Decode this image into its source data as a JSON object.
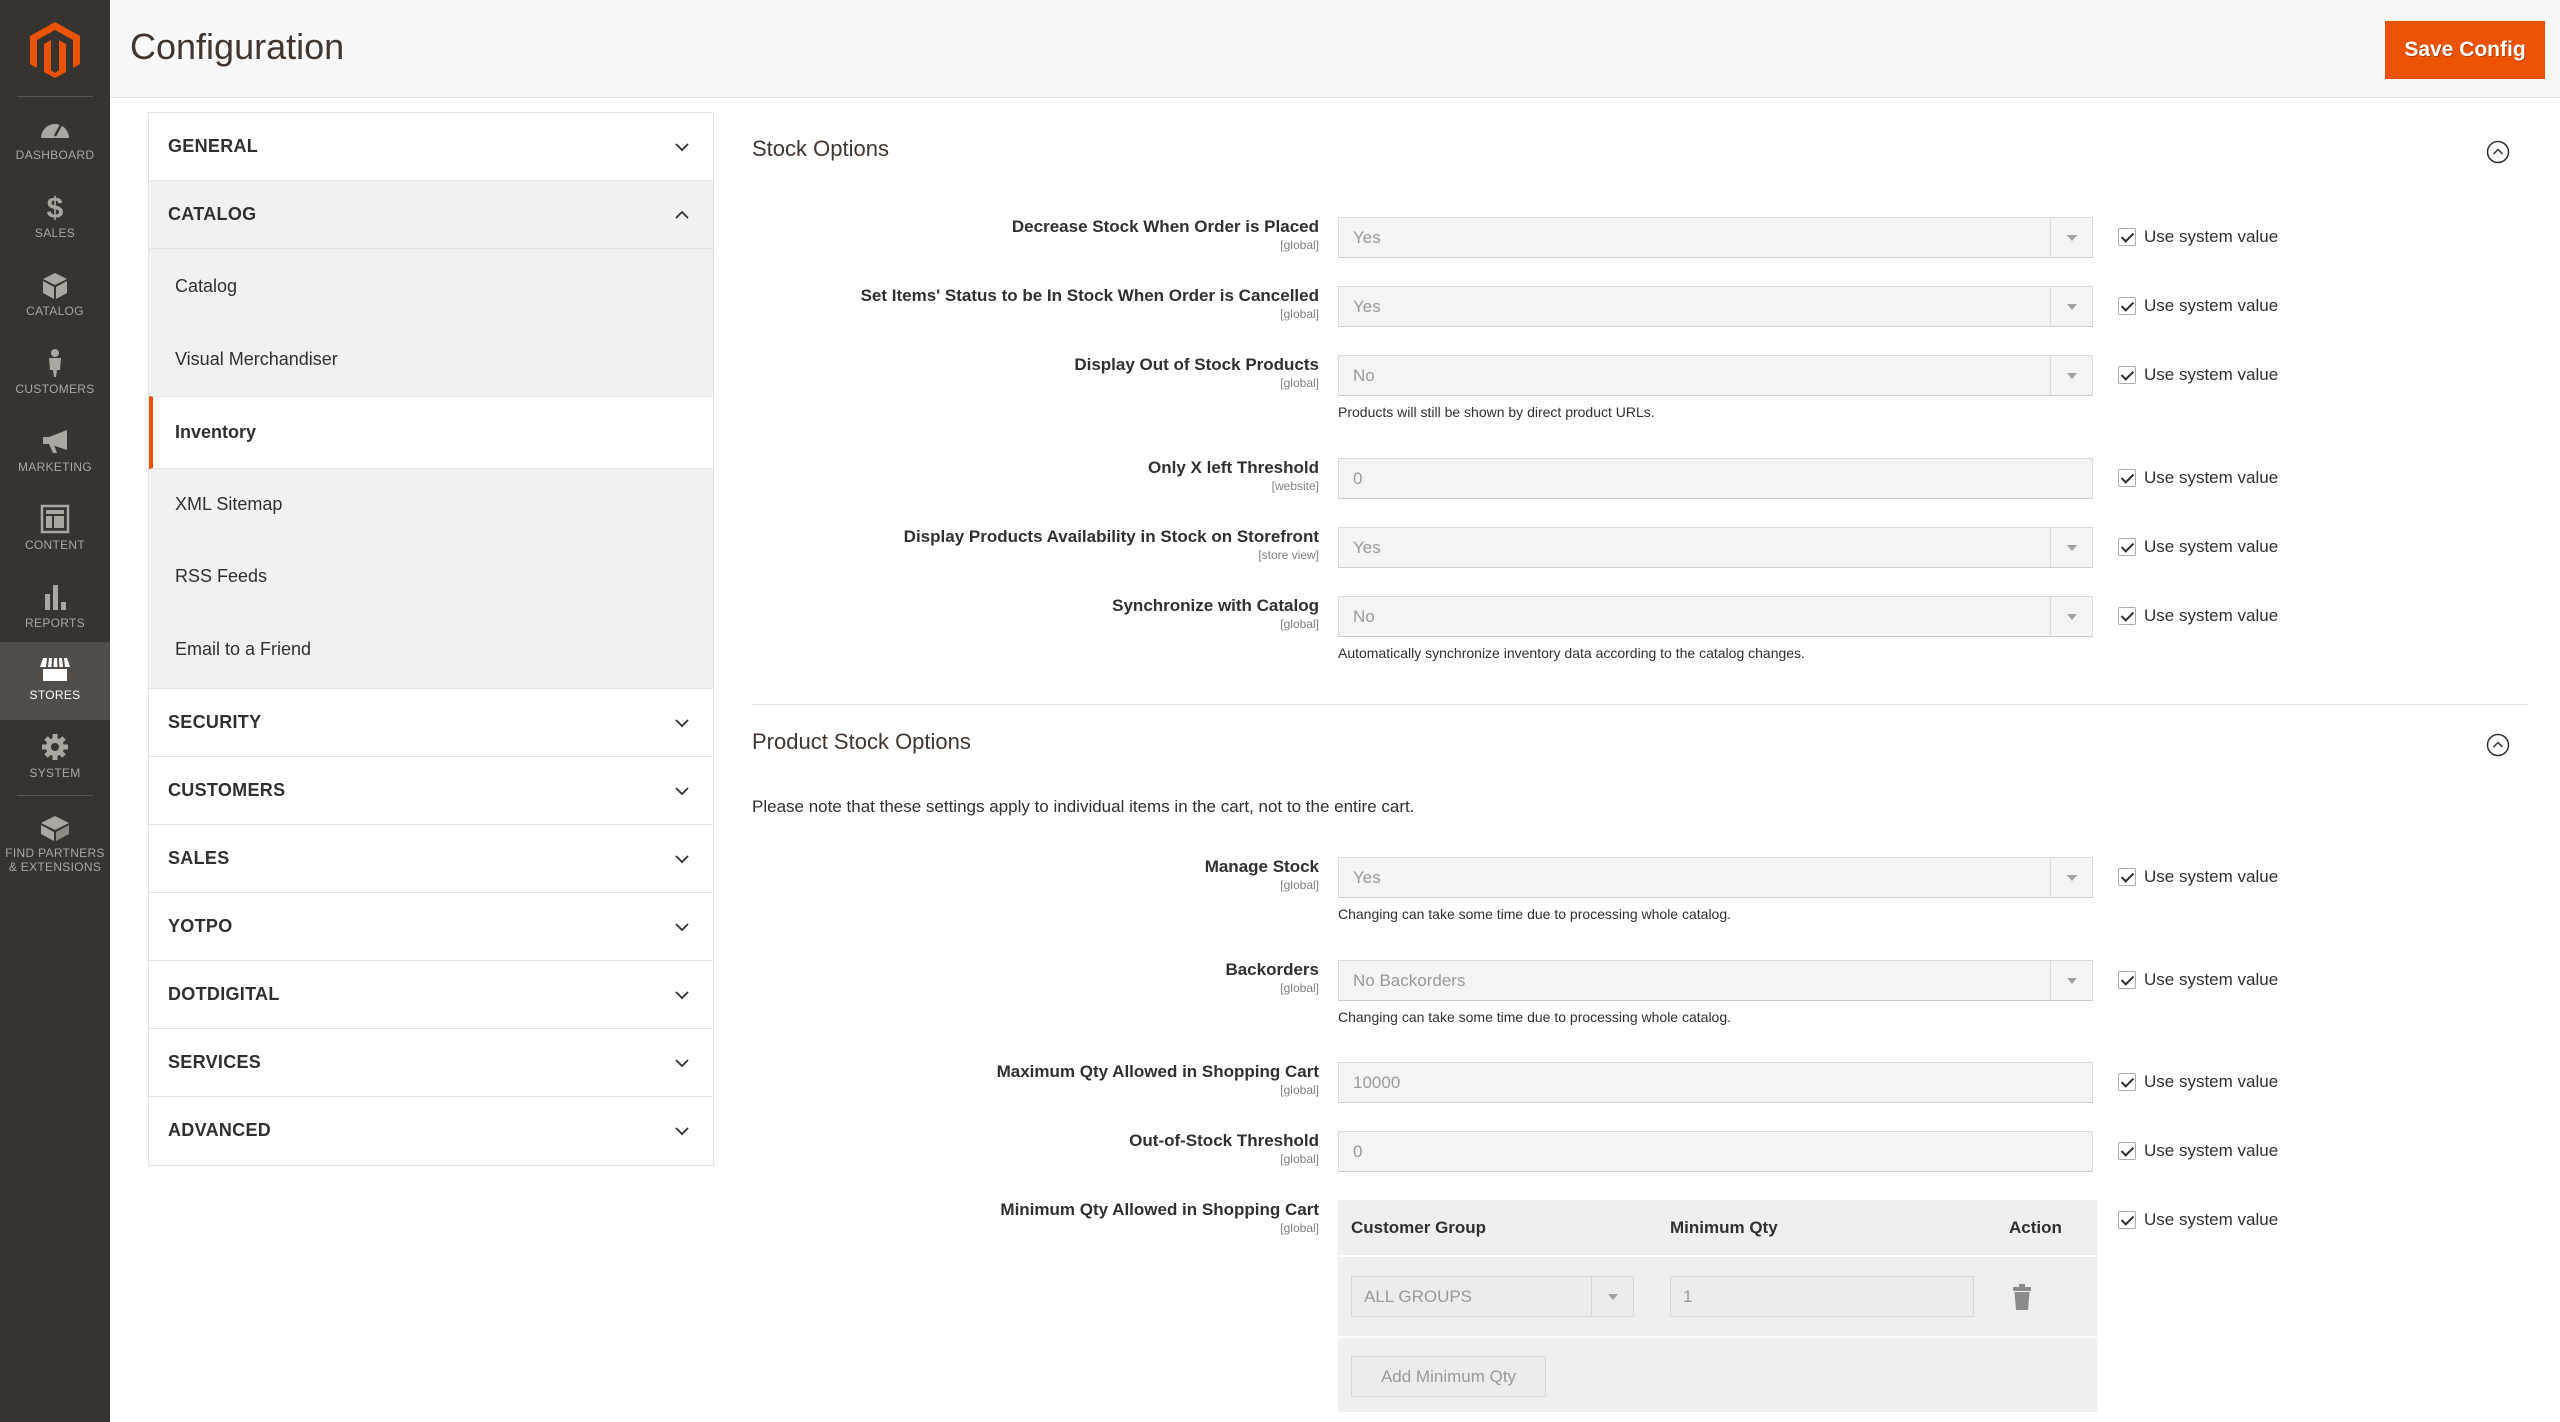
{
  "app": {
    "brand": "Magento"
  },
  "sidebar": {
    "items": [
      {
        "label": "DASHBOARD",
        "icon": "dashboard-icon"
      },
      {
        "label": "SALES",
        "icon": "dollar-icon"
      },
      {
        "label": "CATALOG",
        "icon": "box-icon"
      },
      {
        "label": "CUSTOMERS",
        "icon": "person-icon"
      },
      {
        "label": "MARKETING",
        "icon": "megaphone-icon"
      },
      {
        "label": "CONTENT",
        "icon": "layout-icon"
      },
      {
        "label": "REPORTS",
        "icon": "bar-chart-icon"
      },
      {
        "label": "STORES",
        "icon": "storefront-icon",
        "active": true
      },
      {
        "label": "SYSTEM",
        "icon": "gear-icon"
      },
      {
        "label": "FIND PARTNERS & EXTENSIONS",
        "icon": "blocks-icon"
      }
    ]
  },
  "header": {
    "title": "Configuration",
    "save_label": "Save Config",
    "accent_color": "#eb5202"
  },
  "config_nav": {
    "general": "GENERAL",
    "catalog": "CATALOG",
    "catalog_items": [
      "Catalog",
      "Visual Merchandiser",
      "Inventory",
      "XML Sitemap",
      "RSS Feeds",
      "Email to a Friend"
    ],
    "active_item": "Inventory",
    "collapsed_tabs": [
      "SECURITY",
      "CUSTOMERS",
      "SALES",
      "YOTPO",
      "DOTDIGITAL",
      "SERVICES",
      "ADVANCED"
    ]
  },
  "stock_options": {
    "title": "Stock Options",
    "rows": [
      {
        "label": "Decrease Stock When Order is Placed",
        "scope": "[global]",
        "type": "select",
        "value": "Yes",
        "use_system": true
      },
      {
        "label": "Set Items' Status to be In Stock When Order is Cancelled",
        "scope": "[global]",
        "type": "select",
        "value": "Yes",
        "use_system": true
      },
      {
        "label": "Display Out of Stock Products",
        "scope": "[global]",
        "type": "select",
        "value": "No",
        "use_system": true,
        "note": "Products will still be shown by direct product URLs."
      },
      {
        "label": "Only X left Threshold",
        "scope": "[website]",
        "type": "text",
        "value": "0",
        "use_system": true
      },
      {
        "label": "Display Products Availability in Stock on Storefront",
        "scope": "[store view]",
        "type": "select",
        "value": "Yes",
        "use_system": true
      },
      {
        "label": "Synchronize with Catalog",
        "scope": "[global]",
        "type": "select",
        "value": "No",
        "use_system": true,
        "note": "Automatically synchronize inventory data according to the catalog changes."
      }
    ]
  },
  "product_stock_options": {
    "title": "Product Stock Options",
    "intro": "Please note that these settings apply to individual items in the cart, not to the entire cart.",
    "rows": [
      {
        "label": "Manage Stock",
        "scope": "[global]",
        "type": "select",
        "value": "Yes",
        "use_system": true,
        "note": "Changing can take some time due to processing whole catalog."
      },
      {
        "label": "Backorders",
        "scope": "[global]",
        "type": "select",
        "value": "No Backorders",
        "use_system": true,
        "note": "Changing can take some time due to processing whole catalog."
      },
      {
        "label": "Maximum Qty Allowed in Shopping Cart",
        "scope": "[global]",
        "type": "text",
        "value": "10000",
        "use_system": true
      },
      {
        "label": "Out-of-Stock Threshold",
        "scope": "[global]",
        "type": "text",
        "value": "0",
        "use_system": true
      }
    ],
    "min_qty": {
      "label": "Minimum Qty Allowed in Shopping Cart",
      "scope": "[global]",
      "use_system": true,
      "columns": [
        "Customer Group",
        "Minimum Qty",
        "Action"
      ],
      "rows": [
        {
          "customer_group": "ALL GROUPS",
          "min_qty": "1"
        }
      ],
      "add_label": "Add Minimum Qty"
    }
  },
  "system_value_label": "Use system value"
}
